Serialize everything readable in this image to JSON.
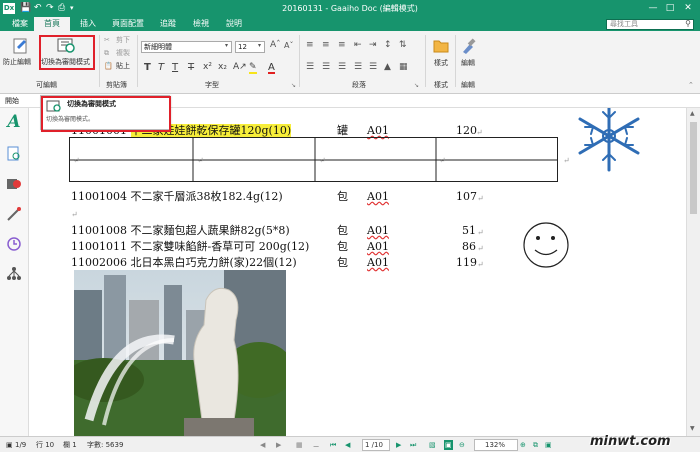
{
  "window": {
    "title": "20160131 - Gaaiho Doc (編輯模式)",
    "app_icon": "Dx",
    "quick_access": [
      "save-icon",
      "undo-icon",
      "redo-icon",
      "print-icon",
      "dropdown-icon"
    ]
  },
  "tabs": [
    "檔案",
    "首頁",
    "插入",
    "頁面配置",
    "追蹤",
    "檢視",
    "說明"
  ],
  "active_tab": "首頁",
  "search": {
    "placeholder": "尋找工具"
  },
  "ribbon": {
    "groups": {
      "edit": {
        "label": "可編輯",
        "btn_protect": "防止編輯",
        "btn_switch": "切換為審閱模式"
      },
      "clipboard": {
        "label": "剪貼簿",
        "cut": "剪下",
        "copy": "複製",
        "paste": "貼上"
      },
      "font": {
        "label": "字型",
        "font_name": "新細明體",
        "font_size": "12"
      },
      "paragraph": {
        "label": "段落"
      },
      "style": {
        "label": "樣式",
        "btn": "樣式"
      },
      "editing": {
        "label": "編輯",
        "btn": "編輯"
      }
    }
  },
  "infobar": {
    "label": "開始"
  },
  "popup": {
    "title": "切換為審閱模式",
    "desc": "切換為審閱模式。"
  },
  "document": {
    "lines": [
      {
        "code": "11001001",
        "name": "不二家娃娃餅乾保存罐120g(10)",
        "unit": "罐",
        "loc": "A01",
        "qty": "120"
      },
      {
        "code": "11001004",
        "name": "不二家千層派38枚182.4g(12)",
        "unit": "包",
        "loc": "A01",
        "qty": "107"
      },
      {
        "code": "11001008",
        "name": "不二家麵包超人蔬果餅82g(5*8)",
        "unit": "包",
        "loc": "A01",
        "qty": "51"
      },
      {
        "code": "11001011",
        "name": "不二家雙味餡餅-香草可可 200g(12)",
        "unit": "包",
        "loc": "A01",
        "qty": "86"
      },
      {
        "code": "11002006",
        "name": "北日本黑白巧克力餅(家)22個(12)",
        "unit": "包",
        "loc": "A01",
        "qty": "119"
      }
    ]
  },
  "status": {
    "page": "1/9",
    "line": "行 10",
    "col": "欄 1",
    "words": "字數: 5639",
    "nav_page": "1 /10",
    "zoom": "132%"
  },
  "watermark": "minwt.com"
}
